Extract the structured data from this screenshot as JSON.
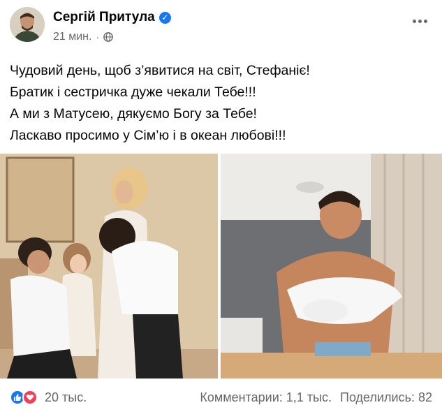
{
  "post": {
    "author": "Сергій Притула",
    "time": "21 мин.",
    "separator": "·",
    "privacy_icon": "globe-icon",
    "verified_icon": "verified-badge-icon",
    "text_lines": [
      "Чудовий день, щоб з’явитися на світ, Стефаніє!",
      "Братик і сестричка дуже чекали Тебе!!!",
      "А ми з Матусею, дякуємо Богу за Тебе!",
      "Ласкаво просимо у Сім’ю і в океан любові!!!"
    ]
  },
  "footer": {
    "reaction_count": "20 тыс.",
    "comments": "Комментарии: 1,1 тыс.",
    "shares": "Поделились: 82"
  },
  "colors": {
    "accent": "#1877f2",
    "love": "#f33e58",
    "secondary_text": "#65676b"
  }
}
